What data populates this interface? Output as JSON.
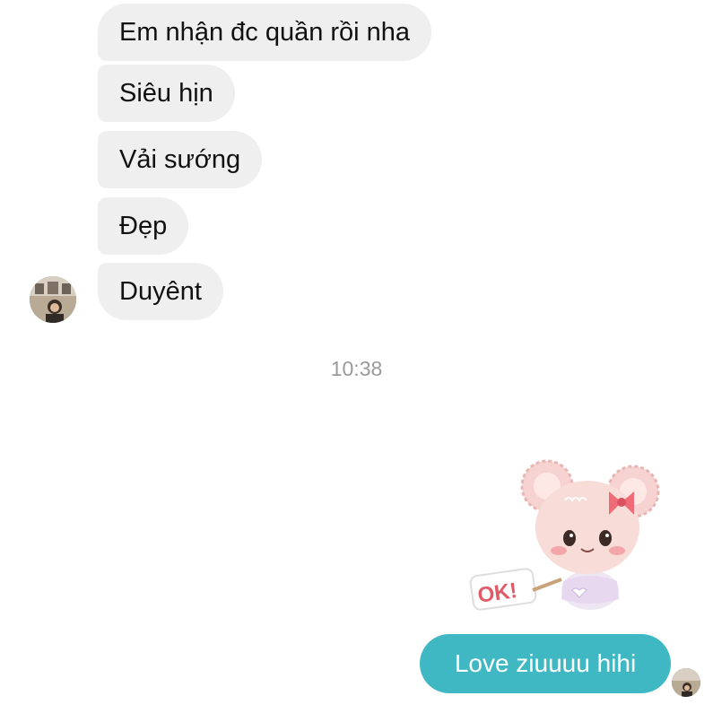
{
  "incoming_messages": [
    "Em nhận đc quần rồi nha",
    "Siêu hịn",
    "Vải sướng",
    "Đẹp",
    "Duyênt"
  ],
  "timestamp": "10:38",
  "sticker": {
    "text": "OK!",
    "description_icon": "bear-sticker-icon",
    "colors": {
      "fur": "#f6d3d1",
      "bow": "#ef6b78",
      "ok_text": "#e05a68"
    }
  },
  "outgoing_message": "Love ziuuuu hihi",
  "colors": {
    "incoming_bubble": "#efefef",
    "outgoing_bubble": "#3fb8c3",
    "timestamp_text": "#9a9a9a"
  }
}
